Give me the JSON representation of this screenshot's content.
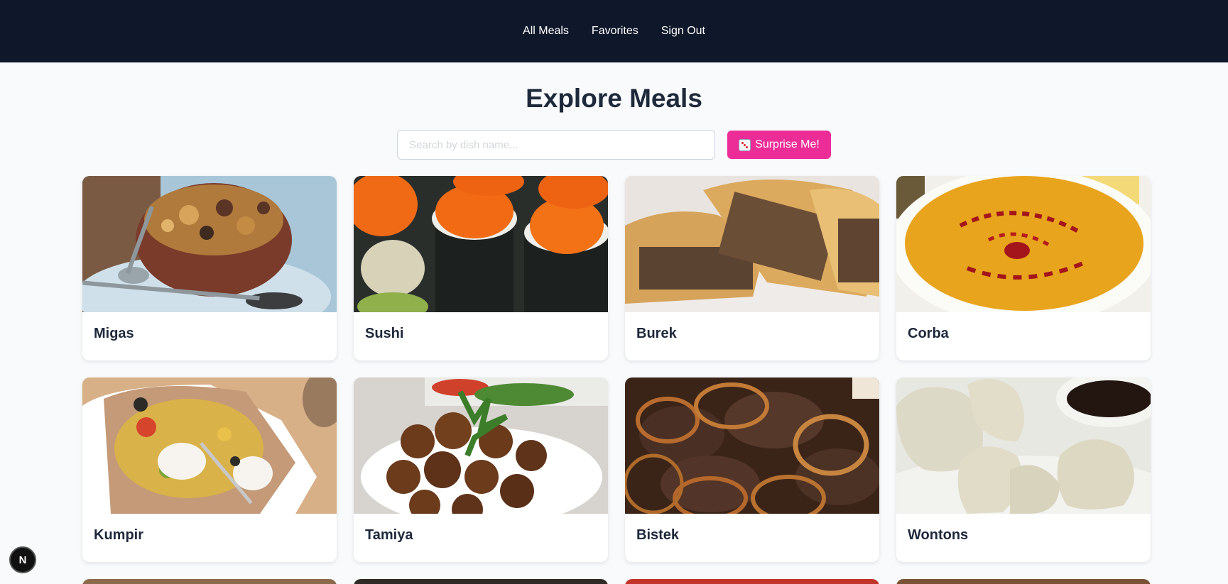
{
  "nav": {
    "items": [
      "All Meals",
      "Favorites",
      "Sign Out"
    ]
  },
  "page": {
    "title": "Explore Meals"
  },
  "search": {
    "placeholder": "Search by dish name...",
    "value": ""
  },
  "surprise_button": {
    "label": "Surprise Me!",
    "icon": "dice-icon"
  },
  "meals": [
    {
      "name": "Migas",
      "image": "migas-photo"
    },
    {
      "name": "Sushi",
      "image": "sushi-photo"
    },
    {
      "name": "Burek",
      "image": "burek-photo"
    },
    {
      "name": "Corba",
      "image": "corba-photo"
    },
    {
      "name": "Kumpir",
      "image": "kumpir-photo"
    },
    {
      "name": "Tamiya",
      "image": "tamiya-photo"
    },
    {
      "name": "Bistek",
      "image": "bistek-photo"
    },
    {
      "name": "Wontons",
      "image": "wontons-photo"
    }
  ],
  "dev_badge": {
    "label": "N"
  },
  "colors": {
    "navbar": "#0f172a",
    "accent": "#ec2d97",
    "background": "#f8fafc"
  }
}
